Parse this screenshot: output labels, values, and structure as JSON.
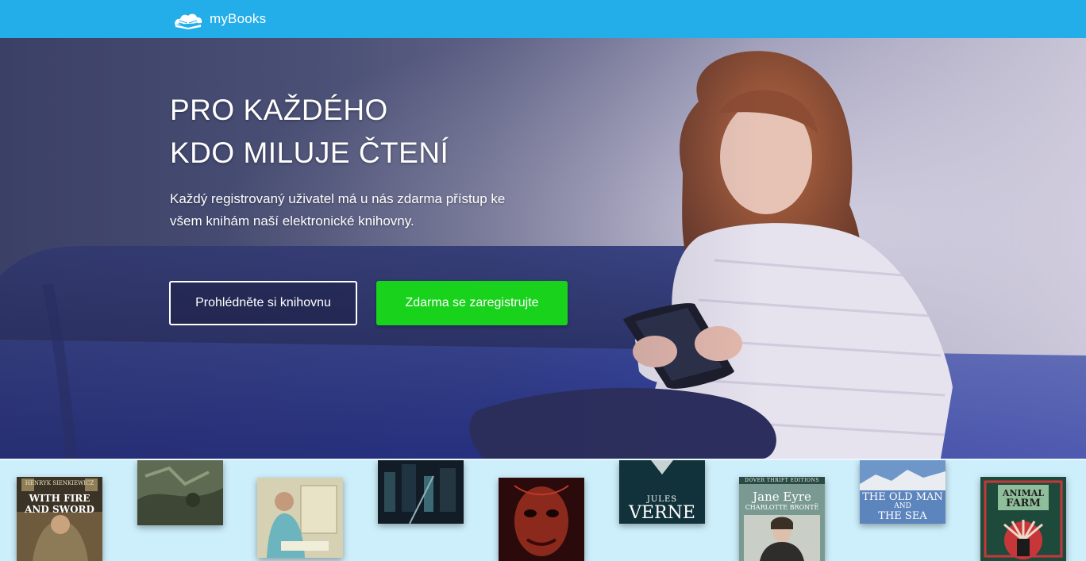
{
  "navbar": {
    "brand_name": "myBooks",
    "brand_icon": "open-book-cloud-icon",
    "background": "#23aeea"
  },
  "hero": {
    "title_line1": "PRO KAŽDÉHO",
    "title_line2": "KDO MILUJE ČTENÍ",
    "text": "Každý registrovaný uživatel má u nás zdarma přístup ke všem knihám naší elektronické knihovny.",
    "button_browse": "Prohlédněte si knihovnu",
    "button_register": "Zdarma se zaregistrujte",
    "register_color": "#18d21b"
  },
  "books": [
    {
      "name": "book-with-fire-and-sword",
      "author": "HENRYK SIENKIEWICZ",
      "title": "WITH FIRE AND SWORD"
    },
    {
      "name": "book-battle-painting"
    },
    {
      "name": "book-woman-reading"
    },
    {
      "name": "book-dark-city"
    },
    {
      "name": "book-red-face"
    },
    {
      "name": "book-jules-verne",
      "author_first": "JULES",
      "author_last": "VERNE"
    },
    {
      "name": "book-jane-eyre",
      "series": "DOVER THRIFT EDITIONS",
      "title": "Jane Eyre",
      "author": "CHARLOTTE BRONTË"
    },
    {
      "name": "book-old-man-and-the-sea",
      "title_line1": "THE OLD MAN",
      "title_line2": "AND",
      "title_line3": "THE SEA"
    },
    {
      "name": "book-animal-farm",
      "title_line1": "ANIMAL",
      "title_line2": "FARM"
    }
  ]
}
